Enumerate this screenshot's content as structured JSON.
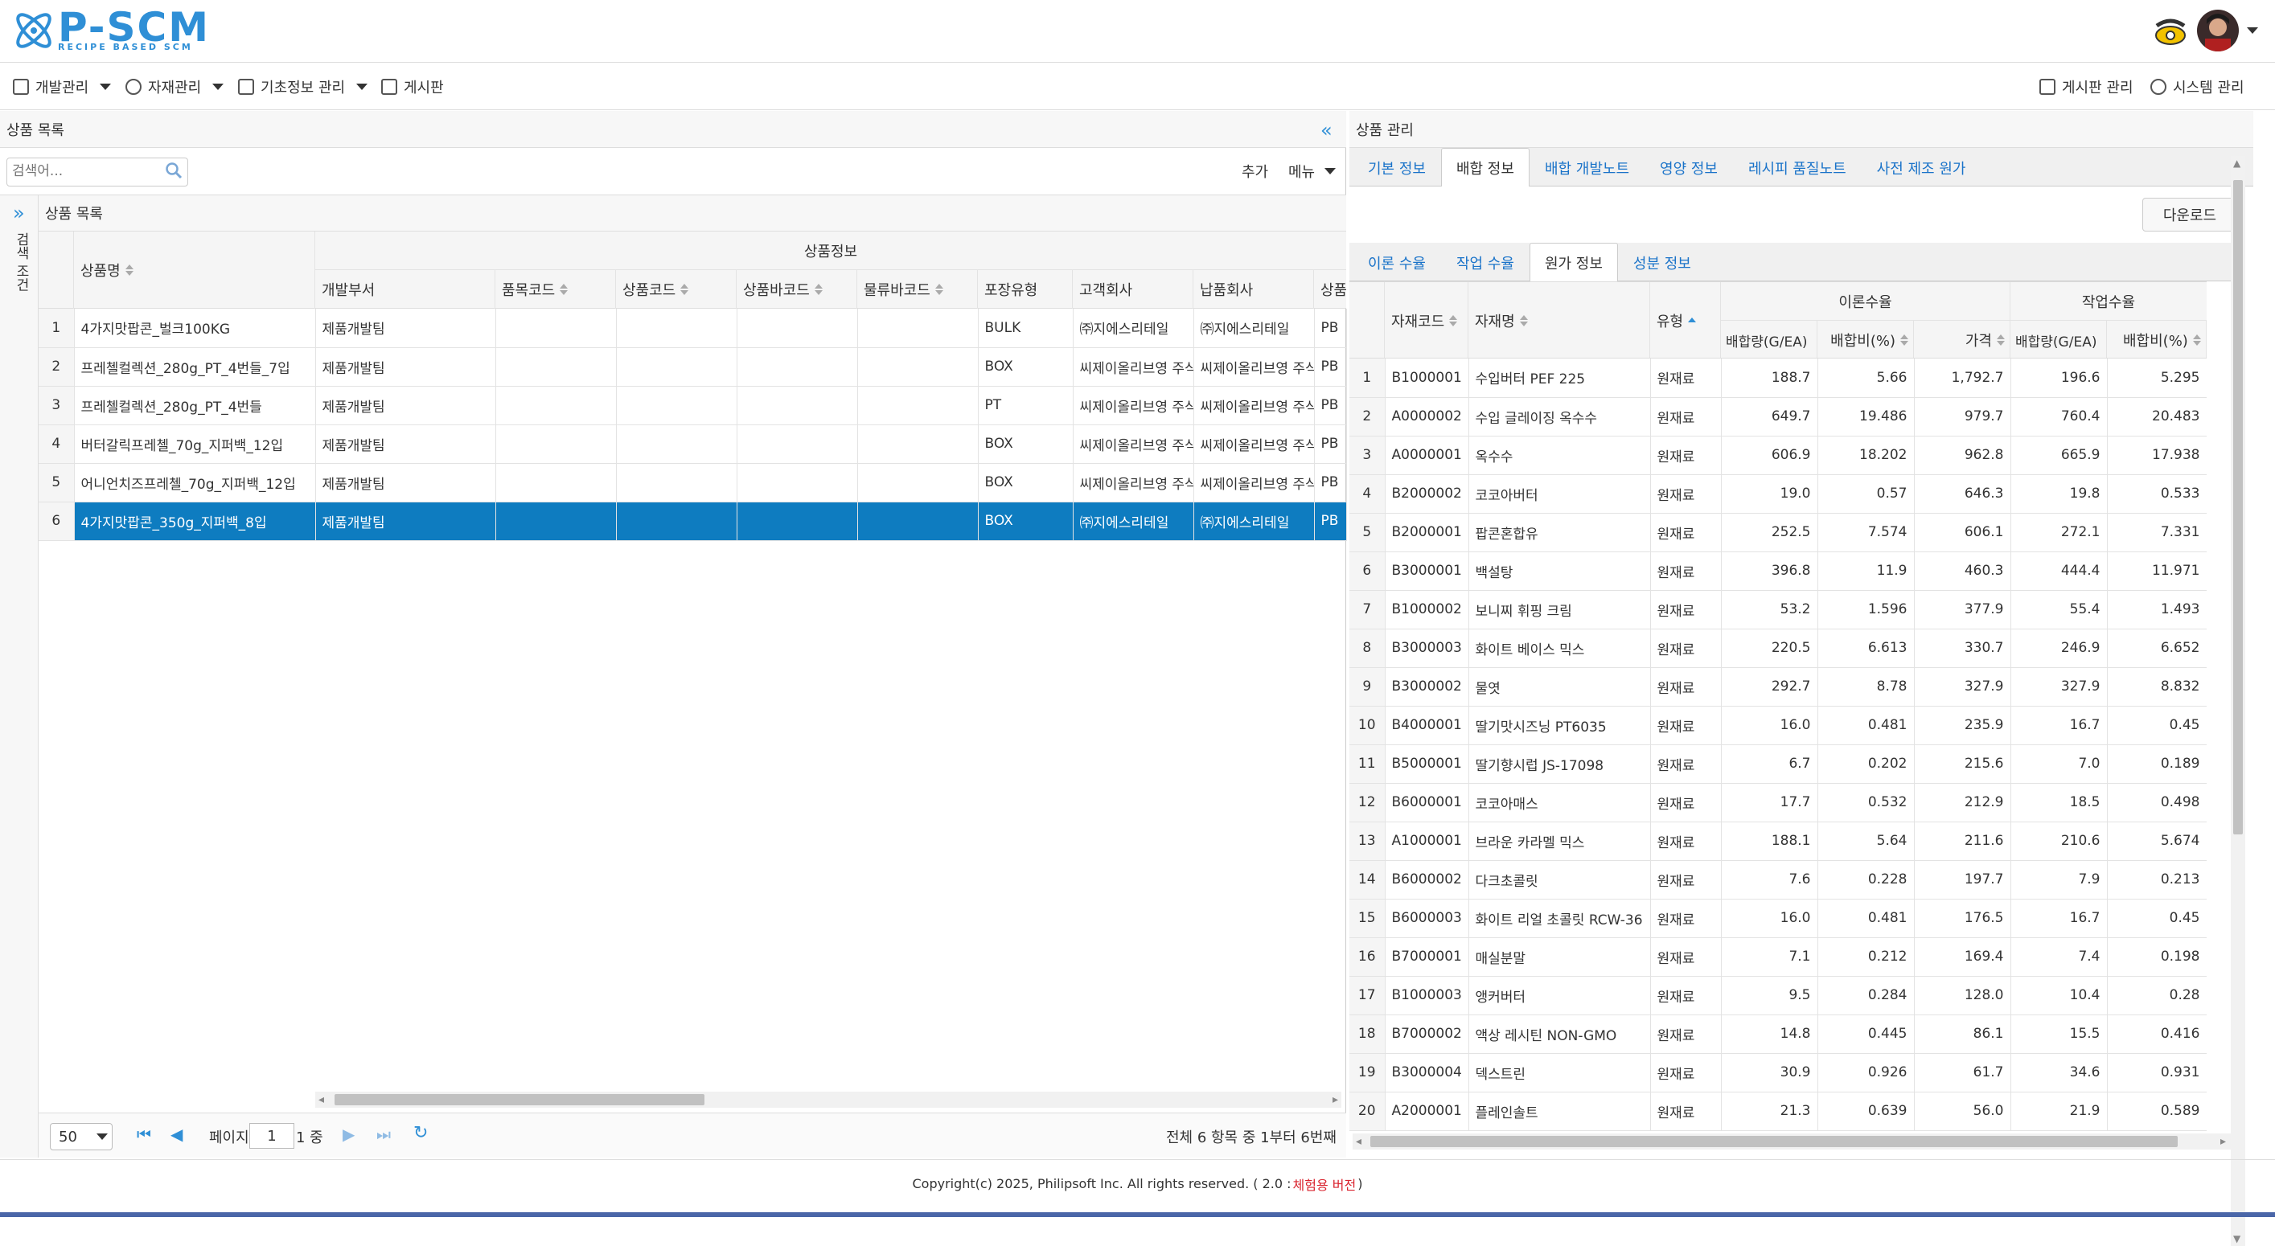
{
  "header": {
    "logo_text": "P-SCM",
    "logo_sub": "RECIPE BASED SCM"
  },
  "menu": {
    "left": [
      {
        "label": "개발관리",
        "icon": "clipboard-icon"
      },
      {
        "label": "자재관리",
        "icon": "palette-icon"
      },
      {
        "label": "기초정보 관리",
        "icon": "id-card-icon"
      },
      {
        "label": "게시판",
        "icon": "board-icon"
      }
    ],
    "right": [
      {
        "label": "게시판 관리",
        "icon": "board-icon"
      },
      {
        "label": "시스템 관리",
        "icon": "gear-icon"
      }
    ]
  },
  "left_panel": {
    "title": "상품 목록",
    "search_placeholder": "검색어...",
    "add_label": "추가",
    "menu_label": "메뉴",
    "side_label": "검색 조건",
    "grid_title": "상품 목록",
    "group_header": "상품정보",
    "columns": [
      "상품명",
      "개발부서",
      "품목코드",
      "상품코드",
      "상품바코드",
      "물류바코드",
      "포장유형",
      "고객회사",
      "납품회사",
      "상품"
    ],
    "rows": [
      {
        "no": "1",
        "cells": [
          "4가지맛팝콘_벌크100KG",
          "제품개발팀",
          "",
          "",
          "",
          "",
          "BULK",
          "㈜지에스리테일",
          "㈜지에스리테일",
          "PB"
        ]
      },
      {
        "no": "2",
        "cells": [
          "프레첼컬렉션_280g_PT_4번들_7입",
          "제품개발팀",
          "",
          "",
          "",
          "",
          "BOX",
          "씨제이올리브영 주식",
          "씨제이올리브영 주식",
          "PB"
        ]
      },
      {
        "no": "3",
        "cells": [
          "프레첼컬렉션_280g_PT_4번들",
          "제품개발팀",
          "",
          "",
          "",
          "",
          "PT",
          "씨제이올리브영 주식",
          "씨제이올리브영 주식",
          "PB"
        ]
      },
      {
        "no": "4",
        "cells": [
          "버터갈릭프레첼_70g_지퍼백_12입",
          "제품개발팀",
          "",
          "",
          "",
          "",
          "BOX",
          "씨제이올리브영 주식",
          "씨제이올리브영 주식",
          "PB"
        ]
      },
      {
        "no": "5",
        "cells": [
          "어니언치즈프레첼_70g_지퍼백_12입",
          "제품개발팀",
          "",
          "",
          "",
          "",
          "BOX",
          "씨제이올리브영 주식",
          "씨제이올리브영 주식",
          "PB"
        ]
      },
      {
        "no": "6",
        "cells": [
          "4가지맛팝콘_350g_지퍼백_8입",
          "제품개발팀",
          "",
          "",
          "",
          "",
          "BOX",
          "㈜지에스리테일",
          "㈜지에스리테일",
          "PB"
        ]
      }
    ],
    "selected_row": 6,
    "page_size": "50",
    "page_label": "페이지",
    "page_value": "1",
    "page_total": "1 중",
    "summary": "전체 6 항목 중 1부터 6번째"
  },
  "right_panel": {
    "title": "상품 관리",
    "tabs": [
      "기본 정보",
      "배합 정보",
      "배합 개발노트",
      "영양 정보",
      "레시피 품질노트",
      "사전 제조 원가"
    ],
    "active_tab": 1,
    "download_label": "다운로드",
    "subtabs": [
      "이론 수율",
      "작업 수율",
      "원가 정보",
      "성분 정보"
    ],
    "active_subtab": 2,
    "group_theory": "이론수율",
    "group_work": "작업수율",
    "columns": [
      "자재코드",
      "자재명",
      "유형",
      "배합량(G/EA)",
      "배합비(%)",
      "가격",
      "배합량(G/EA)",
      "배합비(%)"
    ],
    "rows": [
      {
        "no": "1",
        "code": "B1000001",
        "name": "수입버터 PEF 225",
        "type": "원재료",
        "a": "188.7",
        "b": "5.66",
        "c": "1,792.7",
        "d": "196.6",
        "e": "5.295"
      },
      {
        "no": "2",
        "code": "A0000002",
        "name": "수입 글레이징 옥수수",
        "type": "원재료",
        "a": "649.7",
        "b": "19.486",
        "c": "979.7",
        "d": "760.4",
        "e": "20.483"
      },
      {
        "no": "3",
        "code": "A0000001",
        "name": "옥수수",
        "type": "원재료",
        "a": "606.9",
        "b": "18.202",
        "c": "962.8",
        "d": "665.9",
        "e": "17.938"
      },
      {
        "no": "4",
        "code": "B2000002",
        "name": "코코아버터",
        "type": "원재료",
        "a": "19.0",
        "b": "0.57",
        "c": "646.3",
        "d": "19.8",
        "e": "0.533"
      },
      {
        "no": "5",
        "code": "B2000001",
        "name": "팝콘혼합유",
        "type": "원재료",
        "a": "252.5",
        "b": "7.574",
        "c": "606.1",
        "d": "272.1",
        "e": "7.331"
      },
      {
        "no": "6",
        "code": "B3000001",
        "name": "백설탕",
        "type": "원재료",
        "a": "396.8",
        "b": "11.9",
        "c": "460.3",
        "d": "444.4",
        "e": "11.971"
      },
      {
        "no": "7",
        "code": "B1000002",
        "name": "보니찌 휘핑 크림",
        "type": "원재료",
        "a": "53.2",
        "b": "1.596",
        "c": "377.9",
        "d": "55.4",
        "e": "1.493"
      },
      {
        "no": "8",
        "code": "B3000003",
        "name": "화이트 베이스 믹스",
        "type": "원재료",
        "a": "220.5",
        "b": "6.613",
        "c": "330.7",
        "d": "246.9",
        "e": "6.652"
      },
      {
        "no": "9",
        "code": "B3000002",
        "name": "물엿",
        "type": "원재료",
        "a": "292.7",
        "b": "8.78",
        "c": "327.9",
        "d": "327.9",
        "e": "8.832"
      },
      {
        "no": "10",
        "code": "B4000001",
        "name": "딸기맛시즈닝 PT6035",
        "type": "원재료",
        "a": "16.0",
        "b": "0.481",
        "c": "235.9",
        "d": "16.7",
        "e": "0.45"
      },
      {
        "no": "11",
        "code": "B5000001",
        "name": "딸기향시럽 JS-17098",
        "type": "원재료",
        "a": "6.7",
        "b": "0.202",
        "c": "215.6",
        "d": "7.0",
        "e": "0.189"
      },
      {
        "no": "12",
        "code": "B6000001",
        "name": "코코아매스",
        "type": "원재료",
        "a": "17.7",
        "b": "0.532",
        "c": "212.9",
        "d": "18.5",
        "e": "0.498"
      },
      {
        "no": "13",
        "code": "A1000001",
        "name": "브라운 카라멜 믹스",
        "type": "원재료",
        "a": "188.1",
        "b": "5.64",
        "c": "211.6",
        "d": "210.6",
        "e": "5.674"
      },
      {
        "no": "14",
        "code": "B6000002",
        "name": "다크초콜릿",
        "type": "원재료",
        "a": "7.6",
        "b": "0.228",
        "c": "197.7",
        "d": "7.9",
        "e": "0.213"
      },
      {
        "no": "15",
        "code": "B6000003",
        "name": "화이트 리얼 초콜릿 RCW-36",
        "type": "원재료",
        "a": "16.0",
        "b": "0.481",
        "c": "176.5",
        "d": "16.7",
        "e": "0.45"
      },
      {
        "no": "16",
        "code": "B7000001",
        "name": "매실분말",
        "type": "원재료",
        "a": "7.1",
        "b": "0.212",
        "c": "169.4",
        "d": "7.4",
        "e": "0.198"
      },
      {
        "no": "17",
        "code": "B1000003",
        "name": "앵커버터",
        "type": "원재료",
        "a": "9.5",
        "b": "0.284",
        "c": "128.0",
        "d": "10.4",
        "e": "0.28"
      },
      {
        "no": "18",
        "code": "B7000002",
        "name": "액상 레시틴 NON-GMO",
        "type": "원재료",
        "a": "14.8",
        "b": "0.445",
        "c": "86.1",
        "d": "15.5",
        "e": "0.416"
      },
      {
        "no": "19",
        "code": "B3000004",
        "name": "덱스트린",
        "type": "원재료",
        "a": "30.9",
        "b": "0.926",
        "c": "61.7",
        "d": "34.6",
        "e": "0.931"
      },
      {
        "no": "20",
        "code": "A2000001",
        "name": "플레인솔트",
        "type": "원재료",
        "a": "21.3",
        "b": "0.639",
        "c": "56.0",
        "d": "21.9",
        "e": "0.589"
      }
    ]
  },
  "footer": {
    "copyright": "Copyright(c) 2025, Philipsoft Inc. All rights reserved. ( 2.0 : ",
    "version_label": "체험용 버전",
    "close_paren": " )"
  },
  "colors": {
    "accent": "#2f8fd6",
    "selected": "#0e7cc0",
    "version_red": "#d9232e"
  }
}
